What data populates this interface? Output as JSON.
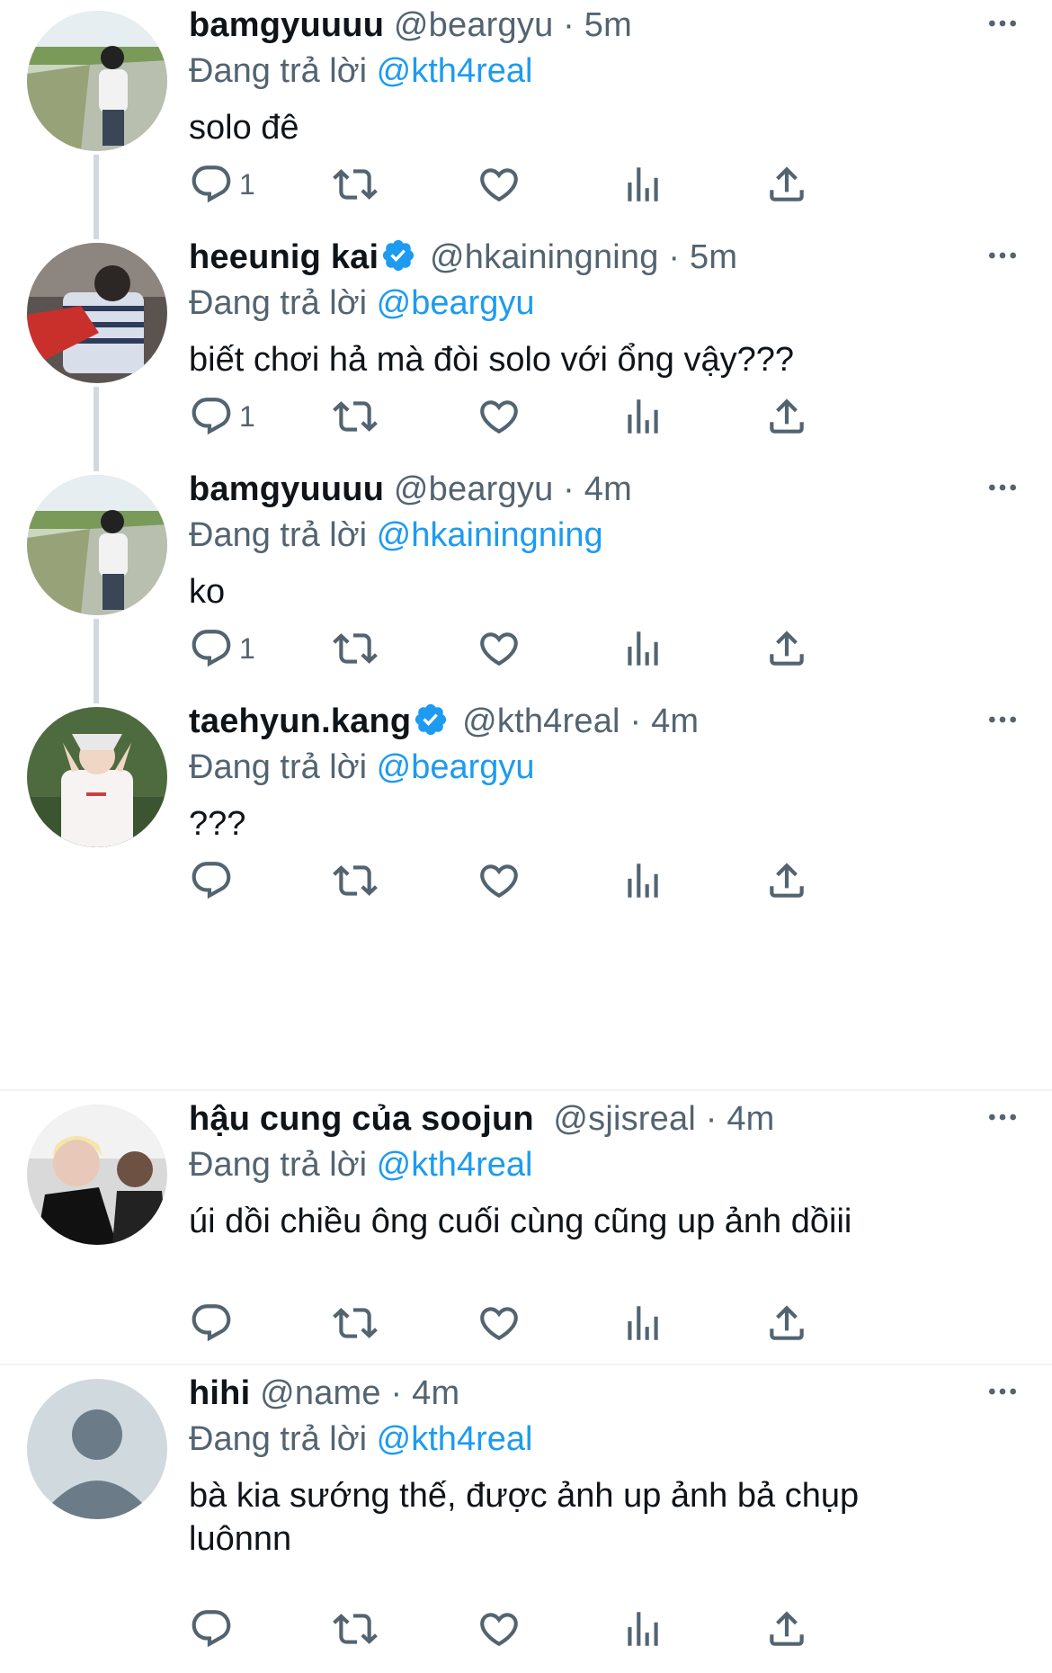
{
  "reply_prefix": "Đang trả lời",
  "colors": {
    "accent": "#1d9bf0",
    "muted": "#536471",
    "text": "#0f1419",
    "line": "#cfd9de"
  },
  "tweets": [
    {
      "name": "bamgyuuuu",
      "handle": "@beargyu",
      "time": "· 5m",
      "reply_to": "@kth4real",
      "text": "solo đê",
      "reply_count": "1",
      "verified": false
    },
    {
      "name": "heeunig kai",
      "handle": "@hkainingning",
      "time": "· 5m",
      "reply_to": "@beargyu",
      "text": "biết chơi hả mà đòi solo với ổng vậy???",
      "reply_count": "1",
      "verified": true
    },
    {
      "name": "bamgyuuuu",
      "handle": "@beargyu",
      "time": "· 4m",
      "reply_to": "@hkainingning",
      "text": "ko",
      "reply_count": "1",
      "verified": false
    },
    {
      "name": "taehyun.kang",
      "handle": "@kth4real",
      "time": "· 4m",
      "reply_to": "@beargyu",
      "text": "???",
      "reply_count": "",
      "verified": true
    },
    {
      "name": "hậu cung của soojun",
      "handle": "@sjisreal",
      "time": "· 4m",
      "reply_to": "@kth4real",
      "text": "úi dồi chiều ông cuối cùng cũng up ảnh dồiii",
      "reply_count": "",
      "verified": false
    },
    {
      "name": "hihi",
      "handle": "@name",
      "time": "· 4m",
      "reply_to": "@kth4real",
      "text": "bà kia sướng thế, được ảnh up ảnh bả chụp\nluônnn",
      "reply_count": "",
      "verified": false
    }
  ],
  "icons": [
    "reply-icon",
    "retweet-icon",
    "like-icon",
    "views-icon",
    "share-icon",
    "more-icon",
    "verified-icon"
  ]
}
